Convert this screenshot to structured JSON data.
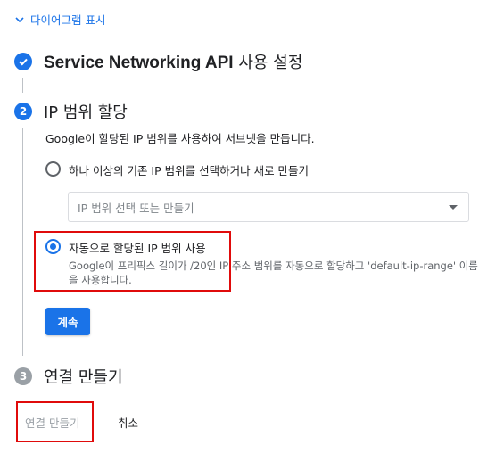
{
  "diagram_toggle": {
    "label": "다이어그램 표시"
  },
  "steps": [
    {
      "number": "",
      "state": "done",
      "title": "Service Networking API",
      "title_suffix": "사용 설정"
    },
    {
      "number": "2",
      "state": "active",
      "title": "IP",
      "title_suffix": "범위 할당"
    },
    {
      "number": "3",
      "state": "pending",
      "title": "",
      "title_suffix": "연결 만들기"
    }
  ],
  "ip_range": {
    "description": "Google이 할당된 IP 범위를 사용하여 서브넷을 만듭니다.",
    "option_existing": {
      "label": "하나 이상의 기존 IP 범위를 선택하거나 새로 만들기",
      "selected": false,
      "select_placeholder": "IP 범위 선택 또는 만들기"
    },
    "option_auto": {
      "label": "자동으로 할당된 IP 범위 사용",
      "help": "Google이 프리픽스 길이가 /20인 IP 주소 범위를 자동으로 할당하고 'default-ip-range' 이름을 사용합니다.",
      "selected": true
    },
    "continue_label": "계속"
  },
  "actions": {
    "create_connection_label": "연결 만들기",
    "cancel_label": "취소"
  },
  "colors": {
    "accent": "#1a73e8",
    "highlight": "#e00b0b",
    "pending": "#9aa0a6"
  }
}
